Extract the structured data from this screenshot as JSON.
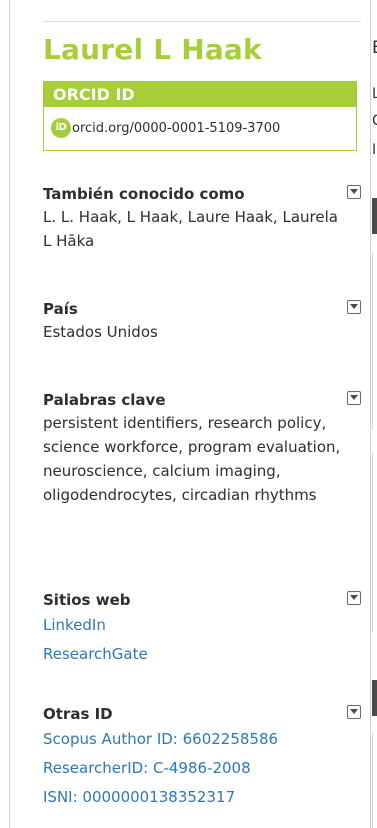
{
  "profile": {
    "name": "Laurel L Haak",
    "orcid_header": "ORCID ID",
    "orcid_logo_text": "iD",
    "orcid_url": "orcid.org/0000-0001-5109-3700"
  },
  "sections": {
    "also_known_as": {
      "title": "También conocido como",
      "text": "L. L. Haak, L Haak, Laure Haak, Laurela L Hāka"
    },
    "country": {
      "title": "País",
      "text": "Estados Unidos"
    },
    "keywords": {
      "title": "Palabras clave",
      "text": "persistent identifiers, research policy, science workforce, program evaluation, neuroscience, calcium imaging, oligodendrocytes, circadian rhythms"
    },
    "websites": {
      "title": "Sitios web",
      "links": [
        "LinkedIn",
        "ResearchGate"
      ]
    },
    "other_ids": {
      "title": "Otras ID",
      "links": [
        "Scopus Author ID: 6602258586",
        "ResearcherID: C-4986-2008",
        "ISNI: 0000000138352317"
      ]
    }
  },
  "icons": {
    "toggle": "chevron-down-icon",
    "logo": "orcid-id-logo"
  },
  "colors": {
    "orcid_green": "#a6ce39",
    "link_blue": "#2e78b4",
    "text": "#2e2e2e"
  },
  "main_clipped": {
    "header_fragment": "E",
    "line1": "L",
    "line2": "C",
    "line3": "I"
  }
}
